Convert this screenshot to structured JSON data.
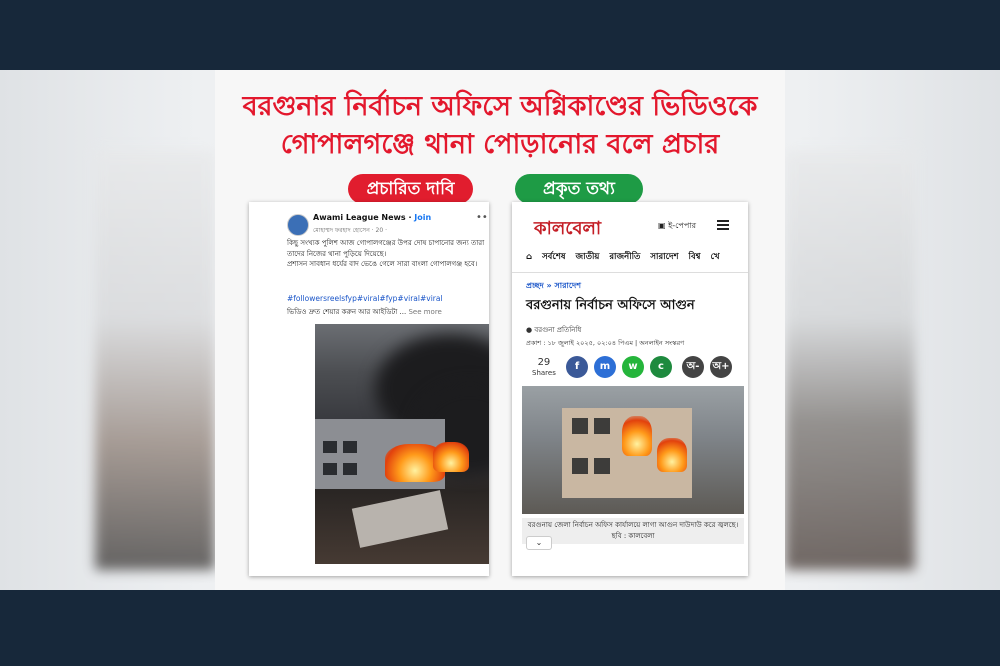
{
  "headline": {
    "line1": "বরগুনার নির্বাচন অফিসে অগ্নিকাণ্ডের ভিডিওকে",
    "line2": "গোপালগঞ্জে থানা পোড়ানোর বলে প্রচার"
  },
  "labels": {
    "claimed": "প্রচারিত দাবি",
    "fact": "প্রকৃত তথ্য"
  },
  "facebook_post": {
    "page_name": "Awami League News",
    "join_label": "Join",
    "subline": "মোহাম্মদ ফরহাদ হোসেন · 20 ·",
    "body_line1": "কিছু সংখ্যক পুলিশ আজ গোপালগঞ্জের উপর দোষ চাপানোর জন্য তারা তাদের নিজের থানা পুড়িয়ে দিয়েছে।",
    "body_line2": "প্রশাসন সাবধান ধর্যের বাদ ভেঙে গেলে সারা বাংলা গোপালগঞ্জ হবে।",
    "hashtags": "#followersreelsfyp#viral#fyp#viral#viral",
    "more_text": "ভিডিও দ্রুত শেয়ার করুন আর আইডিটা ...",
    "see_more": "See more"
  },
  "kalbela": {
    "logo": "কালবেলা",
    "epaper": "ই-পেপার",
    "nav": [
      "সর্বশেষ",
      "জাতীয়",
      "রাজনীতি",
      "সারাদেশ",
      "বিশ্ব",
      "খে"
    ],
    "breadcrumb_home": "প্রচ্ছদ",
    "breadcrumb_section": "সারাদেশ",
    "headline": "বরগুনায় নির্বাচন অফিসে আগুন",
    "author": "বরগুনা প্রতিনিধি",
    "meta": "প্রকাশ : ১৮ জুলাই ২০২৫, ০২:০৪ পিএম  |  অনলাইন সংস্করণ",
    "shares_count": "29",
    "shares_label": "Shares",
    "share_buttons": [
      "f",
      "m",
      "w",
      "c",
      "অ-",
      "অ+"
    ],
    "caption": "বরগুনায় জেলা নির্বাচন অফিস কার্যালয়ে লাগা আগুন দাউদাউ করে জ্বলছে। ছবি : কালবেলা",
    "chevron": "⌄"
  },
  "colors": {
    "headline_red": "#e3182d",
    "claim_red": "#e11d2e",
    "fact_green": "#1e9b45"
  }
}
